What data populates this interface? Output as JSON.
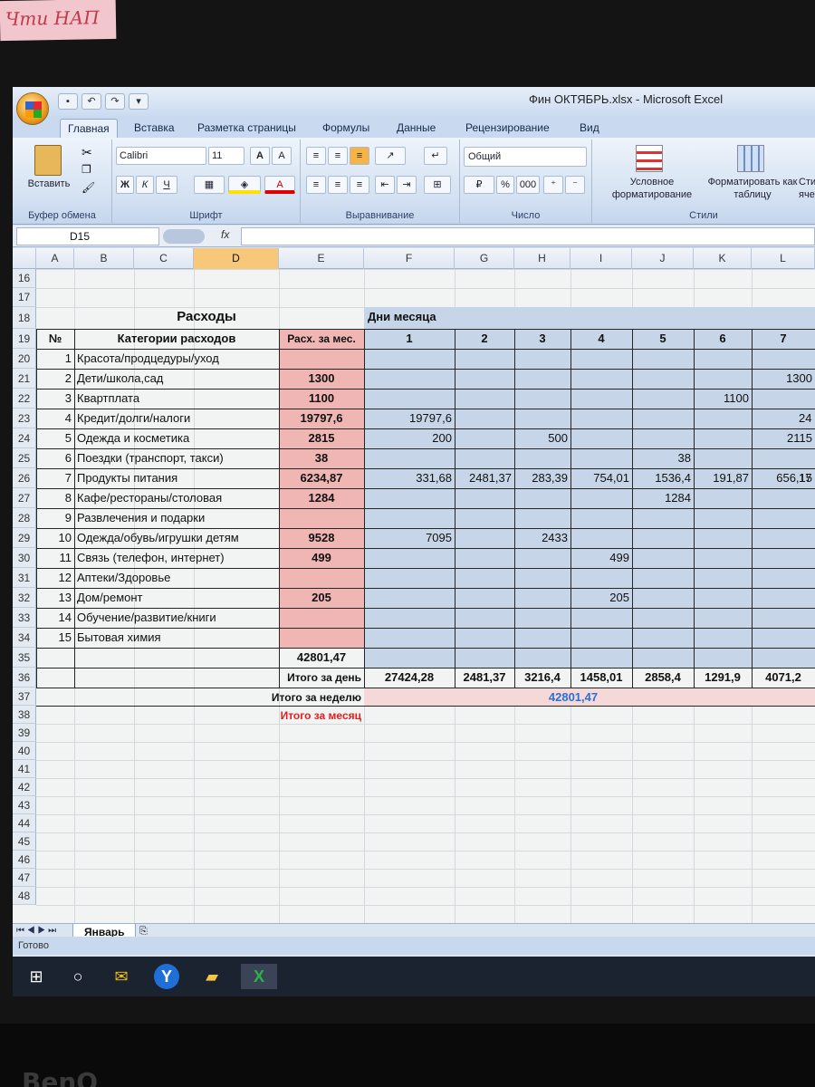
{
  "sticker_text": "Чти НАП",
  "window": {
    "title": "Фин ОКТЯБРЬ.xlsx - Microsoft Excel"
  },
  "ribbon": {
    "tabs": [
      "Главная",
      "Вставка",
      "Разметка страницы",
      "Формулы",
      "Данные",
      "Рецензирование",
      "Вид"
    ],
    "clipboard": {
      "paste": "Вставить",
      "label": "Буфер обмена"
    },
    "font": {
      "name": "Calibri",
      "size": "11",
      "bold": "Ж",
      "italic": "К",
      "underline": "Ч",
      "grow": "A",
      "shrink": "A",
      "color": "A",
      "label": "Шрифт"
    },
    "alignment": {
      "label": "Выравнивание"
    },
    "number": {
      "format": "Общий",
      "percent": "%",
      "thousands": "000",
      "label": "Число"
    },
    "styles": {
      "conditional": "Условное форматирование",
      "table": "Форматировать как таблицу",
      "cell": "Сти ячее",
      "label": "Стили"
    }
  },
  "formula_bar": {
    "name_box": "D15",
    "fx": "fx",
    "value": ""
  },
  "columns": [
    "A",
    "B",
    "C",
    "D",
    "E",
    "F",
    "G",
    "H",
    "I",
    "J",
    "K",
    "L"
  ],
  "sheet": {
    "section_title": "Расходы",
    "days_title": "Дни месяца",
    "header_no": "№",
    "header_category": "Категории расходов",
    "header_month": "Расх. за мес.",
    "days": [
      "1",
      "2",
      "3",
      "4",
      "5",
      "6",
      "7"
    ],
    "rows": [
      {
        "row": "20",
        "no": "1",
        "category": "Красота/продцедуры/уход",
        "month": "",
        "d": [
          "",
          "",
          "",
          "",
          "",
          "",
          ""
        ]
      },
      {
        "row": "21",
        "no": "2",
        "category": "Дети/школа,сад",
        "month": "1300",
        "d": [
          "",
          "",
          "",
          "",
          "",
          "",
          "1300"
        ]
      },
      {
        "row": "22",
        "no": "3",
        "category": "Квартплата",
        "month": "1100",
        "d": [
          "",
          "",
          "",
          "",
          "",
          "1100",
          ""
        ]
      },
      {
        "row": "23",
        "no": "4",
        "category": "Кредит/долги/налоги",
        "month": "19797,6",
        "d": [
          "19797,6",
          "",
          "",
          "",
          "",
          "",
          ""
        ]
      },
      {
        "row": "24",
        "no": "5",
        "category": "Одежда и косметика",
        "month": "2815",
        "d": [
          "200",
          "",
          "500",
          "",
          "",
          "",
          "2115"
        ]
      },
      {
        "row": "25",
        "no": "6",
        "category": "Поездки (транспорт, такси)",
        "month": "38",
        "d": [
          "",
          "",
          "",
          "",
          "38",
          "",
          ""
        ]
      },
      {
        "row": "26",
        "no": "7",
        "category": "Продукты питания",
        "month": "6234,87",
        "d": [
          "331,68",
          "2481,37",
          "283,39",
          "754,01",
          "1536,4",
          "191,87",
          "656,15"
        ]
      },
      {
        "row": "27",
        "no": "8",
        "category": "Кафе/рестораны/столовая",
        "month": "1284",
        "d": [
          "",
          "",
          "",
          "",
          "1284",
          "",
          ""
        ]
      },
      {
        "row": "28",
        "no": "9",
        "category": "Развлечения и подарки",
        "month": "",
        "d": [
          "",
          "",
          "",
          "",
          "",
          "",
          ""
        ]
      },
      {
        "row": "29",
        "no": "10",
        "category": "Одежда/обувь/игрушки детям",
        "month": "9528",
        "d": [
          "7095",
          "",
          "2433",
          "",
          "",
          "",
          ""
        ]
      },
      {
        "row": "30",
        "no": "11",
        "category": "Связь (телефон, интернет)",
        "month": "499",
        "d": [
          "",
          "",
          "",
          "499",
          "",
          "",
          ""
        ]
      },
      {
        "row": "31",
        "no": "12",
        "category": "Аптеки/Здоровье",
        "month": "",
        "d": [
          "",
          "",
          "",
          "",
          "",
          "",
          ""
        ]
      },
      {
        "row": "32",
        "no": "13",
        "category": "Дом/ремонт",
        "month": "205",
        "d": [
          "",
          "",
          "",
          "205",
          "",
          "",
          ""
        ]
      },
      {
        "row": "33",
        "no": "14",
        "category": "Обучение/развитие/книги",
        "month": "",
        "d": [
          "",
          "",
          "",
          "",
          "",
          "",
          ""
        ]
      },
      {
        "row": "34",
        "no": "15",
        "category": "Бытовая химия",
        "month": "",
        "d": [
          "",
          "",
          "",
          "",
          "",
          "",
          ""
        ]
      }
    ],
    "month_total": "42801,47",
    "label_day_total": "Итого за день",
    "day_totals": [
      "27424,28",
      "2481,37",
      "3216,4",
      "1458,01",
      "2858,4",
      "1291,9",
      "4071,2"
    ],
    "label_week_total": "Итого за неделю",
    "week_total": "42801,47",
    "label_month_total": "Итого за месяц",
    "cut_right": {
      "row23": "24",
      "row26": "17"
    }
  },
  "row_numbers": [
    "16",
    "17",
    "18",
    "19",
    "20",
    "21",
    "22",
    "23",
    "24",
    "25",
    "26",
    "27",
    "28",
    "29",
    "30",
    "31",
    "32",
    "33",
    "34",
    "35",
    "36",
    "37",
    "38",
    "39",
    "40",
    "41",
    "42",
    "43",
    "44",
    "45",
    "46",
    "47",
    "48"
  ],
  "sheet_tab": "Январь",
  "status": "Готово",
  "monitor_brand": "BenQ",
  "colors": {
    "pink": "#f0b6b4",
    "blue": "#c6d5e8",
    "red_label": "#e02020",
    "blue_total": "#2a6fd6"
  }
}
